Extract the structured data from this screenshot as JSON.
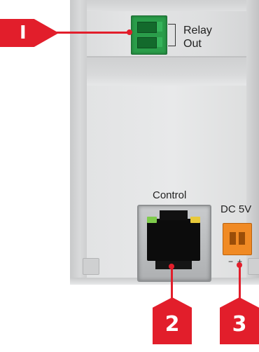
{
  "relay": {
    "label_line1": "Relay",
    "label_line2": "Out",
    "connector_color": "#2a9d4a"
  },
  "control": {
    "label": "Control",
    "led_left_color": "#7ecb4b",
    "led_right_color": "#e8c93a"
  },
  "dc": {
    "label": "DC 5V",
    "polarity": "−+",
    "connector_color": "#f08a24"
  },
  "callouts": {
    "color": "#e21e2b",
    "one": "I",
    "two": "2",
    "three": "3"
  }
}
